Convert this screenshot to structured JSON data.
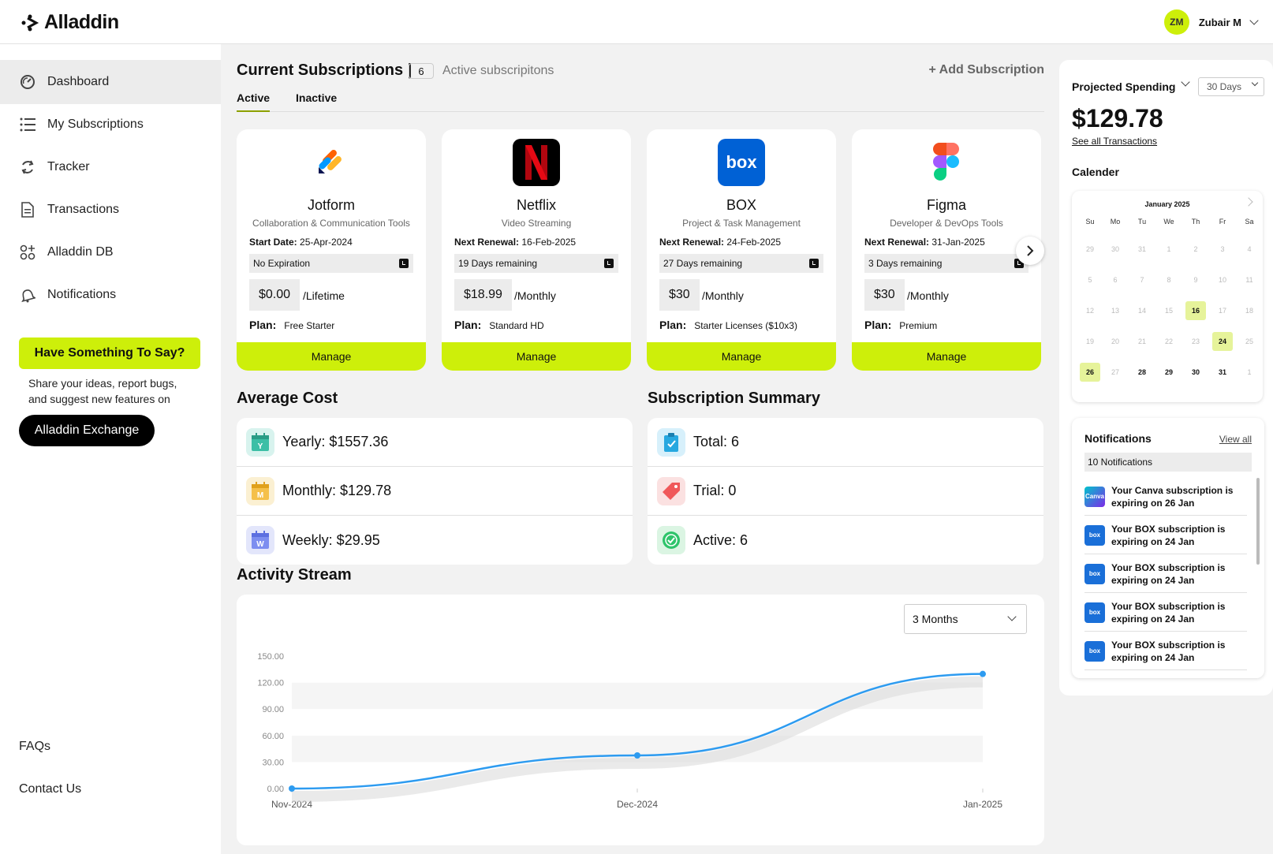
{
  "app": {
    "name": "Alladdin"
  },
  "user": {
    "initials": "ZM",
    "name": "Zubair M"
  },
  "sidebar": {
    "items": [
      {
        "label": "Dashboard",
        "icon": "dashboard-icon"
      },
      {
        "label": "My Subscriptions",
        "icon": "list-icon"
      },
      {
        "label": "Tracker",
        "icon": "refresh-icon"
      },
      {
        "label": "Transactions",
        "icon": "document-icon"
      },
      {
        "label": "Alladdin DB",
        "icon": "grid-icon"
      },
      {
        "label": "Notifications",
        "icon": "bell-icon"
      }
    ],
    "feedback_label": "Have Something To Say?",
    "feedback_text": "Share your ideas, report bugs, and suggest new features on",
    "exchange_label": "Alladdin Exchange",
    "faqs": "FAQs",
    "contact": "Contact Us"
  },
  "subscriptions": {
    "title": "Current Subscriptions |",
    "count": "6",
    "count_label": "Active subscripitons",
    "add_label": "+ Add Subscription",
    "tabs": [
      "Active",
      "Inactive"
    ],
    "cards": [
      {
        "name": "Jotform",
        "category": "Collaboration & Communication Tools",
        "date_label": "Start Date:",
        "date": "25-Apr-2024",
        "status": "No Expiration",
        "price": "$0.00",
        "period": "/Lifetime",
        "plan_label": "Plan:",
        "plan": "Free Starter",
        "manage": "Manage"
      },
      {
        "name": "Netflix",
        "category": "Video Streaming",
        "date_label": "Next Renewal:",
        "date": "16-Feb-2025",
        "status": "19 Days remaining",
        "price": "$18.99",
        "period": "/Monthly",
        "plan_label": "Plan:",
        "plan": "Standard HD",
        "manage": "Manage"
      },
      {
        "name": "BOX",
        "category": "Project & Task Management",
        "date_label": "Next Renewal:",
        "date": "24-Feb-2025",
        "status": "27 Days remaining",
        "price": "$30",
        "period": "/Monthly",
        "plan_label": "Plan:",
        "plan": "Starter Licenses ($10x3)",
        "manage": "Manage"
      },
      {
        "name": "Figma",
        "category": "Developer & DevOps Tools",
        "date_label": "Next Renewal:",
        "date": "31-Jan-2025",
        "status": "3 Days remaining",
        "price": "$30",
        "period": "/Monthly",
        "plan_label": "Plan:",
        "plan": "Premium",
        "manage": "Manage"
      }
    ]
  },
  "average_cost": {
    "title": "Average Cost",
    "rows": [
      "Yearly: $1557.36",
      "Monthly: $129.78",
      "Weekly: $29.95"
    ]
  },
  "summary": {
    "title": "Subscription Summary",
    "rows": [
      "Total: 6",
      "Trial: 0",
      "Active: 6"
    ]
  },
  "activity": {
    "title": "Activity Stream",
    "range": "3 Months",
    "line_color": "#2d9bf0"
  },
  "chart_data": {
    "type": "line",
    "x": [
      "Nov-2024",
      "Dec-2024",
      "Jan-2025"
    ],
    "series": [
      {
        "values": [
          0,
          37.5,
          129.78
        ]
      }
    ],
    "ylim": [
      0,
      150
    ],
    "yticks": [
      "0.00",
      "30.00",
      "60.00",
      "90.00",
      "120.00",
      "150.00"
    ],
    "grid": true
  },
  "projected": {
    "title": "Projected Spending",
    "range": "30 Days",
    "amount": "$129.78",
    "link": "See all Transactions"
  },
  "calendar": {
    "title": "Calender",
    "month": "January 2025",
    "weekdays": [
      "Su",
      "Mo",
      "Tu",
      "We",
      "Th",
      "Fr",
      "Sa"
    ],
    "weeks": [
      [
        "29",
        "30",
        "31",
        "1",
        "2",
        "3",
        "4"
      ],
      [
        "5",
        "6",
        "7",
        "8",
        "9",
        "10",
        "11"
      ],
      [
        "12",
        "13",
        "14",
        "15",
        "16",
        "17",
        "18"
      ],
      [
        "19",
        "20",
        "21",
        "22",
        "23",
        "24",
        "25"
      ],
      [
        "26",
        "27",
        "28",
        "29",
        "30",
        "31",
        "1"
      ]
    ]
  },
  "notifications": {
    "title": "Notifications",
    "view_all": "View all",
    "count": "10 Notifications",
    "items": [
      {
        "logo": "Canva",
        "text": "Your Canva subscription is expiring on 26 Jan"
      },
      {
        "logo": "box",
        "text": "Your BOX subscription is expiring on 24 Jan"
      },
      {
        "logo": "box",
        "text": "Your BOX subscription is expiring on 24 Jan"
      },
      {
        "logo": "box",
        "text": "Your BOX subscription is expiring on 24 Jan"
      },
      {
        "logo": "box",
        "text": "Your BOX subscription is expiring on 24 Jan"
      }
    ]
  },
  "colors": {
    "accent": "#cdef0a",
    "highlight": "#e6f39a",
    "netflix": "#e50914",
    "box": "#0061d5"
  }
}
